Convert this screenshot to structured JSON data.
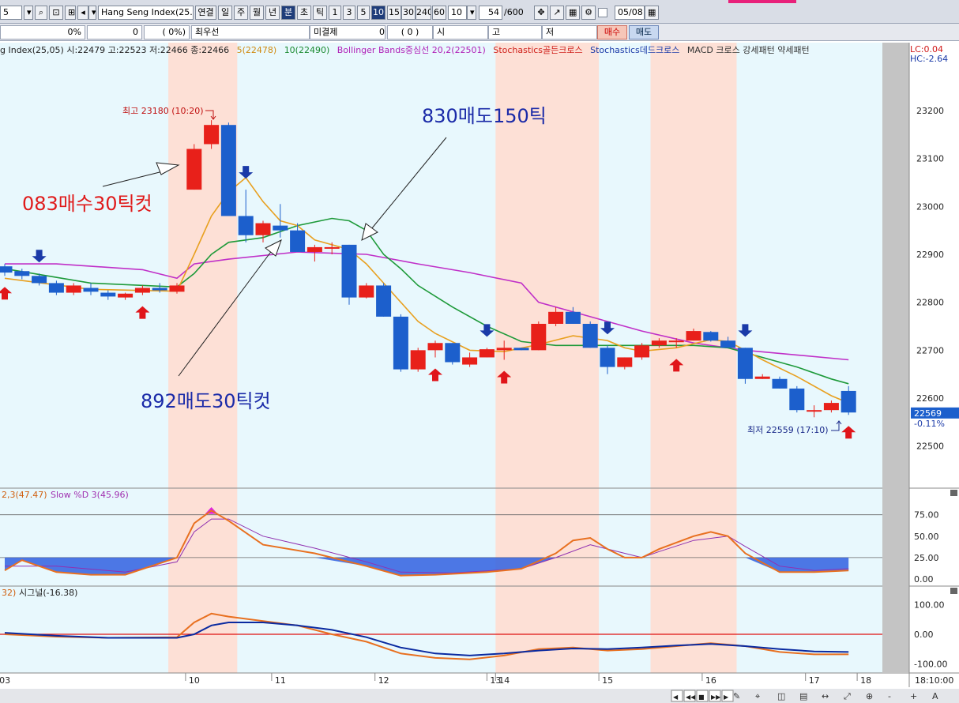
{
  "toolbar": {
    "code": "5",
    "search_icon": "search-icon",
    "symbol": "Hang Seng Index(25.0",
    "period_buttons": [
      "연결",
      "일",
      "주",
      "월",
      "년",
      "분",
      "초",
      "틱"
    ],
    "minute_buttons": [
      "1",
      "3",
      "5",
      "10",
      "15",
      "30",
      "240",
      "60"
    ],
    "interval_value": "10",
    "count_value": "54",
    "count_total": "/600",
    "date_value": "05/08",
    "tools": [
      "crosshair-icon",
      "chart-tool-icon",
      "grid-icon",
      "settings-icon"
    ]
  },
  "order_bar": {
    "pct1": "0%",
    "qty": "0",
    "pct2": "(     0%)",
    "label1": "최우선",
    "label2": "미결제",
    "qty2": "0",
    "paren": "(      0      )",
    "label3": "시",
    "label4": "고",
    "label5": "저",
    "buy_label": "매수",
    "sell_label": "매도"
  },
  "legend": {
    "main": "g Index(25,05) 시:22479 고:22523 저:22466 종:22466",
    "ma5": "5(22478)",
    "ma10": "10(22490)",
    "bb": "Bollinger Bands중심선 20,2(22501)",
    "stoch_gold": "Stochastics골든크로스",
    "stoch_dead": "Stochastics데드크로스",
    "macd": "MACD 크로스 강세패턴  약세패턴"
  },
  "right_info": {
    "lc": "LC:0.04",
    "hc": "HC:-2.64",
    "last": "22569",
    "chg": "-0.11%"
  },
  "annotations": {
    "high": "최고 23180 (10:20)",
    "low": "최저 22559 (17:10)",
    "buy": "083매수30틱컷",
    "sell150": "830매도150틱",
    "sell30": "892매도30틱컷"
  },
  "stoch_legend": {
    "k": "2,3(47.47)",
    "d": "Slow %D 3(45.96)"
  },
  "macd_legend": {
    "m": "32)",
    "sig": "시그널(-16.38)"
  },
  "bottom_time": "18:10:00",
  "colors": {
    "up": "#e8201a",
    "down": "#1c5fcc",
    "ma5": "#e8a020",
    "ma10": "#1e9a3a",
    "bb": "#c030c8",
    "stoch_k": "#e87020",
    "stoch_d": "#9030b0",
    "macd": "#e87020",
    "signal": "#0a2aa0",
    "shade": "#fde0d6",
    "bg": "#e8f8fd"
  },
  "chart_data": {
    "type": "candlestick",
    "price_axis": {
      "ticks": [
        23200,
        23100,
        23000,
        22900,
        22800,
        22700,
        22600,
        22500
      ]
    },
    "x_labels": [
      "03",
      "10",
      "11",
      "12",
      "13",
      "14",
      "15",
      "16",
      "17",
      "18"
    ],
    "candles": [
      [
        22875,
        22880,
        22855,
        22862
      ],
      [
        22865,
        22870,
        22848,
        22855
      ],
      [
        22855,
        22860,
        22835,
        22840
      ],
      [
        22840,
        22845,
        22815,
        22820
      ],
      [
        22820,
        22840,
        22815,
        22835
      ],
      [
        22830,
        22840,
        22815,
        22822
      ],
      [
        22820,
        22825,
        22805,
        22812
      ],
      [
        22810,
        22820,
        22805,
        22818
      ],
      [
        22820,
        22835,
        22815,
        22830
      ],
      [
        22830,
        22840,
        22820,
        22825
      ],
      [
        22822,
        22840,
        22818,
        22835
      ],
      [
        23035,
        23130,
        23035,
        23120
      ],
      [
        23130,
        23180,
        23120,
        23170
      ],
      [
        23170,
        23175,
        22985,
        22980
      ],
      [
        22980,
        23035,
        22925,
        22940
      ],
      [
        22940,
        22970,
        22925,
        22965
      ],
      [
        22960,
        23005,
        22935,
        22950
      ],
      [
        22950,
        22965,
        22905,
        22905
      ],
      [
        22905,
        22920,
        22885,
        22915
      ],
      [
        22915,
        22925,
        22900,
        22915
      ],
      [
        22920,
        22920,
        22795,
        22810
      ],
      [
        22810,
        22840,
        22808,
        22835
      ],
      [
        22835,
        22840,
        22770,
        22770
      ],
      [
        22770,
        22775,
        22655,
        22660
      ],
      [
        22660,
        22705,
        22655,
        22700
      ],
      [
        22700,
        22720,
        22685,
        22715
      ],
      [
        22715,
        22715,
        22670,
        22675
      ],
      [
        22670,
        22695,
        22665,
        22685
      ],
      [
        22685,
        22705,
        22685,
        22702
      ],
      [
        22700,
        22720,
        22680,
        22705
      ],
      [
        22705,
        22705,
        22700,
        22700
      ],
      [
        22700,
        22760,
        22700,
        22755
      ],
      [
        22755,
        22790,
        22750,
        22780
      ],
      [
        22780,
        22790,
        22755,
        22755
      ],
      [
        22755,
        22760,
        22705,
        22705
      ],
      [
        22705,
        22710,
        22650,
        22665
      ],
      [
        22665,
        22685,
        22660,
        22685
      ],
      [
        22685,
        22715,
        22680,
        22710
      ],
      [
        22710,
        22725,
        22705,
        22720
      ],
      [
        22720,
        22725,
        22705,
        22720
      ],
      [
        22720,
        22745,
        22720,
        22740
      ],
      [
        22738,
        22740,
        22718,
        22720
      ],
      [
        22720,
        22728,
        22705,
        22705
      ],
      [
        22705,
        22705,
        22630,
        22640
      ],
      [
        22640,
        22650,
        22640,
        22645
      ],
      [
        22640,
        22645,
        22620,
        22620
      ],
      [
        22620,
        22625,
        22570,
        22575
      ],
      [
        22575,
        22585,
        22560,
        22575
      ],
      [
        22575,
        22595,
        22570,
        22590
      ],
      [
        22615,
        22625,
        22565,
        22570
      ]
    ],
    "ma5": [
      [
        0,
        22850
      ],
      [
        5,
        22827
      ],
      [
        10,
        22823
      ],
      [
        11,
        22900
      ],
      [
        12,
        22980
      ],
      [
        13,
        23030
      ],
      [
        14,
        23060
      ],
      [
        15,
        23010
      ],
      [
        16,
        22970
      ],
      [
        17,
        22960
      ],
      [
        18,
        22930
      ],
      [
        20,
        22910
      ],
      [
        21,
        22880
      ],
      [
        22,
        22840
      ],
      [
        23,
        22800
      ],
      [
        24,
        22760
      ],
      [
        25,
        22735
      ],
      [
        27,
        22700
      ],
      [
        29,
        22697
      ],
      [
        31,
        22712
      ],
      [
        33,
        22730
      ],
      [
        35,
        22720
      ],
      [
        36,
        22705
      ],
      [
        37,
        22698
      ],
      [
        39,
        22705
      ],
      [
        41,
        22722
      ],
      [
        42,
        22718
      ],
      [
        43,
        22700
      ],
      [
        44,
        22680
      ],
      [
        46,
        22645
      ],
      [
        48,
        22605
      ],
      [
        49,
        22590
      ]
    ],
    "ma10": [
      [
        0,
        22870
      ],
      [
        5,
        22840
      ],
      [
        10,
        22832
      ],
      [
        11,
        22860
      ],
      [
        12,
        22900
      ],
      [
        13,
        22925
      ],
      [
        15,
        22935
      ],
      [
        17,
        22960
      ],
      [
        19,
        22975
      ],
      [
        20,
        22970
      ],
      [
        21,
        22950
      ],
      [
        22,
        22900
      ],
      [
        23,
        22870
      ],
      [
        24,
        22835
      ],
      [
        26,
        22790
      ],
      [
        28,
        22750
      ],
      [
        30,
        22718
      ],
      [
        32,
        22710
      ],
      [
        36,
        22710
      ],
      [
        40,
        22710
      ],
      [
        42,
        22705
      ],
      [
        44,
        22685
      ],
      [
        46,
        22665
      ],
      [
        48,
        22640
      ],
      [
        49,
        22630
      ]
    ],
    "bb": [
      [
        0,
        22880
      ],
      [
        3,
        22880
      ],
      [
        8,
        22868
      ],
      [
        10,
        22850
      ],
      [
        11,
        22880
      ],
      [
        13,
        22890
      ],
      [
        17,
        22905
      ],
      [
        21,
        22900
      ],
      [
        24,
        22880
      ],
      [
        27,
        22862
      ],
      [
        30,
        22840
      ],
      [
        31,
        22800
      ],
      [
        34,
        22770
      ],
      [
        37,
        22740
      ],
      [
        40,
        22715
      ],
      [
        43,
        22700
      ],
      [
        46,
        22690
      ],
      [
        49,
        22680
      ]
    ],
    "stoch_k": [
      [
        0,
        10
      ],
      [
        1,
        22
      ],
      [
        3,
        8
      ],
      [
        5,
        5
      ],
      [
        7,
        5
      ],
      [
        10,
        25
      ],
      [
        11,
        65
      ],
      [
        12,
        80
      ],
      [
        13,
        68
      ],
      [
        15,
        40
      ],
      [
        18,
        30
      ],
      [
        21,
        15
      ],
      [
        23,
        4
      ],
      [
        25,
        5
      ],
      [
        28,
        8
      ],
      [
        30,
        12
      ],
      [
        32,
        30
      ],
      [
        33,
        45
      ],
      [
        34,
        48
      ],
      [
        35,
        35
      ],
      [
        36,
        25
      ],
      [
        37,
        25
      ],
      [
        38,
        35
      ],
      [
        40,
        50
      ],
      [
        41,
        55
      ],
      [
        42,
        50
      ],
      [
        43,
        30
      ],
      [
        45,
        8
      ],
      [
        47,
        8
      ],
      [
        49,
        10
      ]
    ],
    "stoch_d": [
      [
        0,
        15
      ],
      [
        3,
        15
      ],
      [
        7,
        8
      ],
      [
        10,
        20
      ],
      [
        11,
        55
      ],
      [
        12,
        70
      ],
      [
        13,
        70
      ],
      [
        15,
        50
      ],
      [
        18,
        36
      ],
      [
        21,
        20
      ],
      [
        23,
        8
      ],
      [
        26,
        7
      ],
      [
        30,
        12
      ],
      [
        32,
        25
      ],
      [
        34,
        40
      ],
      [
        36,
        30
      ],
      [
        37,
        25
      ],
      [
        38,
        32
      ],
      [
        40,
        45
      ],
      [
        42,
        50
      ],
      [
        43,
        38
      ],
      [
        45,
        15
      ],
      [
        47,
        10
      ],
      [
        49,
        12
      ]
    ],
    "macd": [
      [
        0,
        0
      ],
      [
        3,
        -8
      ],
      [
        6,
        -12
      ],
      [
        10,
        -10
      ],
      [
        11,
        40
      ],
      [
        12,
        70
      ],
      [
        13,
        60
      ],
      [
        15,
        45
      ],
      [
        17,
        30
      ],
      [
        19,
        0
      ],
      [
        21,
        -25
      ],
      [
        23,
        -65
      ],
      [
        25,
        -80
      ],
      [
        27,
        -85
      ],
      [
        29,
        -72
      ],
      [
        31,
        -50
      ],
      [
        33,
        -45
      ],
      [
        35,
        -55
      ],
      [
        37,
        -50
      ],
      [
        39,
        -40
      ],
      [
        41,
        -30
      ],
      [
        43,
        -40
      ],
      [
        45,
        -60
      ],
      [
        47,
        -68
      ],
      [
        49,
        -68
      ]
    ],
    "signal": [
      [
        0,
        5
      ],
      [
        3,
        -5
      ],
      [
        6,
        -12
      ],
      [
        10,
        -12
      ],
      [
        11,
        0
      ],
      [
        12,
        30
      ],
      [
        13,
        40
      ],
      [
        15,
        40
      ],
      [
        17,
        30
      ],
      [
        19,
        15
      ],
      [
        21,
        -10
      ],
      [
        23,
        -45
      ],
      [
        25,
        -65
      ],
      [
        27,
        -72
      ],
      [
        29,
        -65
      ],
      [
        31,
        -55
      ],
      [
        33,
        -48
      ],
      [
        35,
        -50
      ],
      [
        37,
        -45
      ],
      [
        39,
        -38
      ],
      [
        41,
        -33
      ],
      [
        43,
        -40
      ],
      [
        45,
        -50
      ],
      [
        47,
        -58
      ],
      [
        49,
        -60
      ]
    ],
    "buy_arrows": [
      0,
      8,
      25,
      29,
      39,
      49
    ],
    "sell_arrows": [
      2,
      14,
      28,
      35,
      43
    ],
    "shaded": [
      [
        10,
        14
      ],
      [
        29,
        35
      ],
      [
        38,
        43
      ]
    ],
    "stoch_ticks": [
      75,
      50,
      25,
      0
    ],
    "macd_ticks": [
      100,
      0,
      -100
    ]
  }
}
